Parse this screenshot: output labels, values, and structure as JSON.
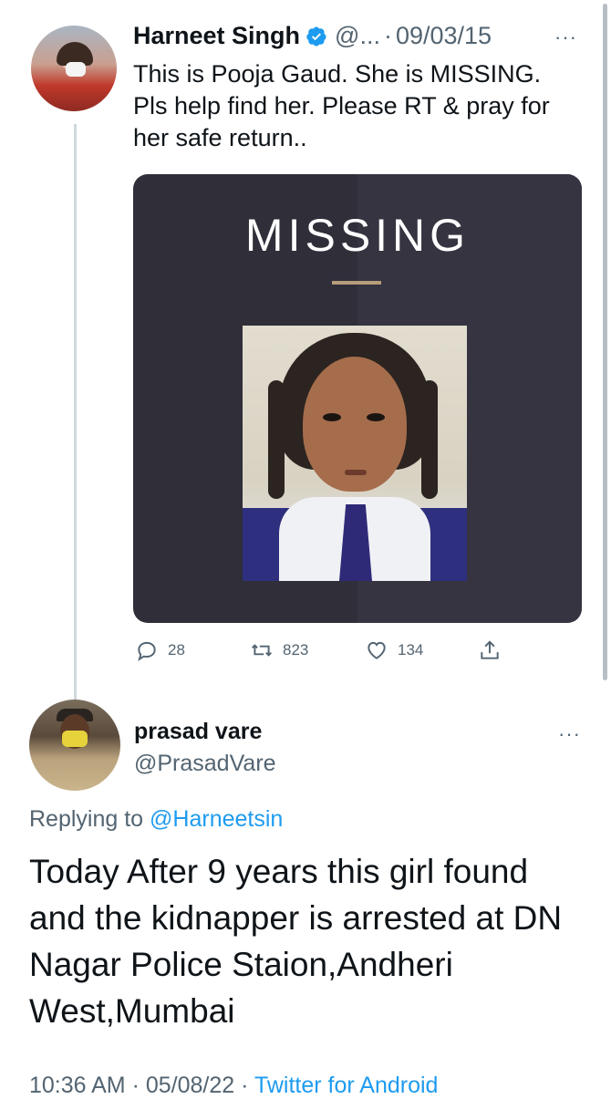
{
  "tweet1": {
    "author_name": "Harneet Singh",
    "handle": "@...",
    "separator": "·",
    "date": "09/03/15",
    "more": "···",
    "text": "This is Pooja Gaud. She is MISSING. Pls help find her. Please RT & pray for her safe return..",
    "media": {
      "heading": "MISSING"
    },
    "actions": {
      "replies": "28",
      "retweets": "823",
      "likes": "134"
    },
    "avatar_icon": "profile-photo"
  },
  "tweet2": {
    "author_name": "prasad vare",
    "handle": "@PrasadVare",
    "more": "···",
    "replying_prefix": "Replying to",
    "replying_to": "@Harneetsin",
    "text": "Today After 9 years this girl found and the kidnapper is arrested at DN Nagar Police Staion,Andheri West,Mumbai",
    "time": "10:36 AM",
    "sep1": "·",
    "date": "05/08/22",
    "sep2": "·",
    "source": "Twitter for Android",
    "avatar_icon": "profile-photo"
  },
  "colors": {
    "accent": "#1d9bf0",
    "secondary_text": "#536471",
    "card_bg": "#2f2e39"
  }
}
